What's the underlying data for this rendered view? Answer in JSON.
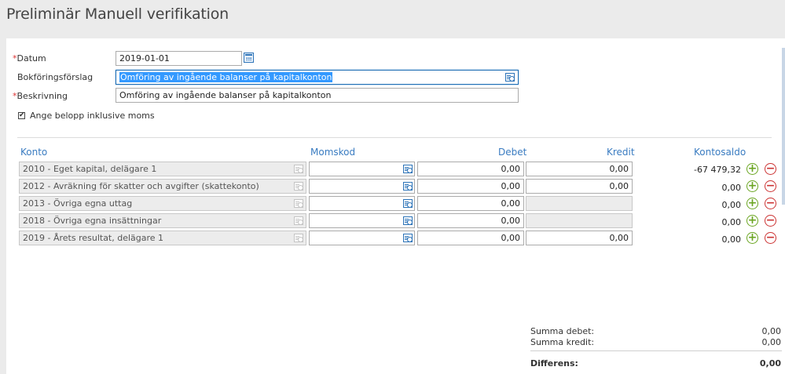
{
  "page": {
    "title": "Preliminär Manuell verifikation"
  },
  "form": {
    "datum": {
      "label": "Datum",
      "value": "2019-01-01"
    },
    "bokforingsforslag": {
      "label": "Bokföringsförslag",
      "value": "Omföring av ingående balanser på kapitalkonton"
    },
    "beskrivning": {
      "label": "Beskrivning",
      "value": "Omföring av ingående balanser på kapitalkonton"
    },
    "moms_checkbox": {
      "label": "Ange belopp inklusive moms",
      "checked": true
    },
    "required_mark": "*"
  },
  "table": {
    "headers": {
      "konto": "Konto",
      "momskod": "Momskod",
      "debet": "Debet",
      "kredit": "Kredit",
      "kontosaldo": "Kontosaldo"
    },
    "rows": [
      {
        "konto": "2010 - Eget kapital, delägare 1",
        "momskod": "",
        "debet": "0,00",
        "kredit": "0,00",
        "saldo": "-67 479,32",
        "debet_readonly": false,
        "kredit_readonly": false
      },
      {
        "konto": "2012 - Avräkning för skatter och avgifter (skattekonto)",
        "momskod": "",
        "debet": "0,00",
        "kredit": "0,00",
        "saldo": "0,00",
        "debet_readonly": false,
        "kredit_readonly": false
      },
      {
        "konto": "2013 - Övriga egna uttag",
        "momskod": "",
        "debet": "0,00",
        "kredit": "",
        "saldo": "0,00",
        "debet_readonly": false,
        "kredit_readonly": true
      },
      {
        "konto": "2018 - Övriga egna insättningar",
        "momskod": "",
        "debet": "0,00",
        "kredit": "",
        "saldo": "0,00",
        "debet_readonly": false,
        "kredit_readonly": true
      },
      {
        "konto": "2019 - Årets resultat, delägare 1",
        "momskod": "",
        "debet": "0,00",
        "kredit": "0,00",
        "saldo": "0,00",
        "debet_readonly": false,
        "kredit_readonly": false
      }
    ],
    "add_symbol": "+",
    "remove_symbol": "−"
  },
  "summary": {
    "summa_debet": {
      "label": "Summa debet:",
      "value": "0,00"
    },
    "summa_kredit": {
      "label": "Summa kredit:",
      "value": "0,00"
    },
    "differens": {
      "label": "Differens:",
      "value": "0,00"
    }
  },
  "icons": {
    "calendar": "calendar-icon",
    "lookup": "lookup-list-icon",
    "add": "plus-circle-icon",
    "remove": "minus-circle-icon",
    "checkbox": "checkbox-icon"
  },
  "colors": {
    "accent": "#3a7cc1",
    "add": "#6aa521",
    "remove": "#cc3333",
    "selection": "#3399ff"
  }
}
